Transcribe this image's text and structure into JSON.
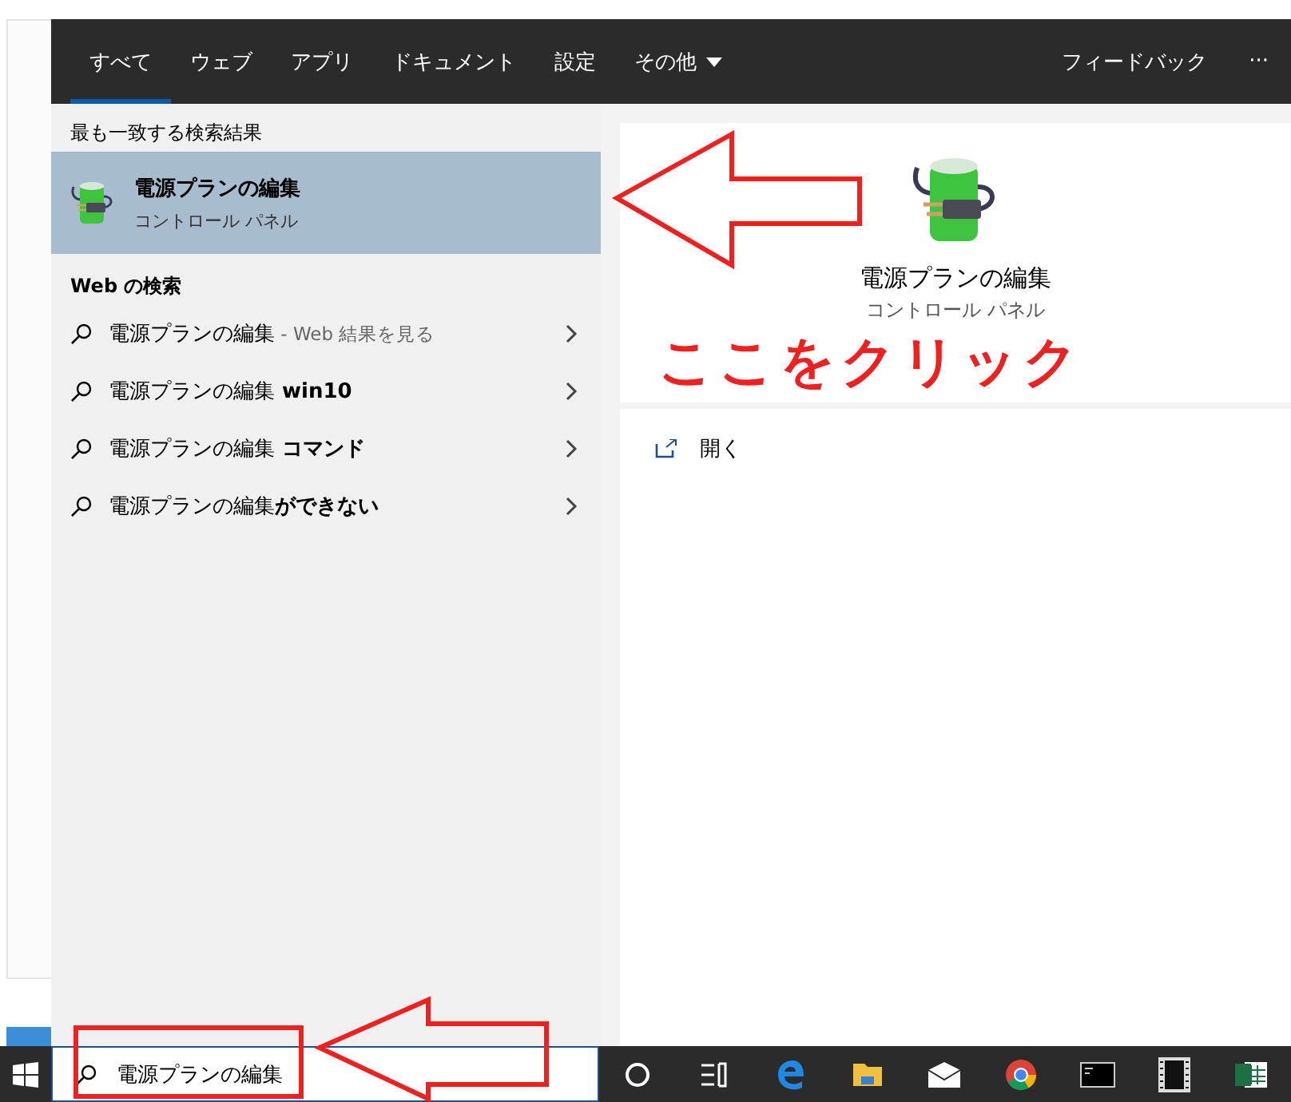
{
  "tabs": [
    {
      "label": "すべて",
      "selected": true,
      "dropdown": false
    },
    {
      "label": "ウェブ",
      "selected": false,
      "dropdown": false
    },
    {
      "label": "アプリ",
      "selected": false,
      "dropdown": false
    },
    {
      "label": "ドキュメント",
      "selected": false,
      "dropdown": false
    },
    {
      "label": "設定",
      "selected": false,
      "dropdown": false
    },
    {
      "label": "その他",
      "selected": false,
      "dropdown": true
    }
  ],
  "toolbar": {
    "feedback": "フィードバック",
    "more": "···"
  },
  "best_match": {
    "heading": "最も一致する検索結果",
    "title": "電源プランの編集",
    "subtitle": "コントロール パネル",
    "selected": true
  },
  "web_search": {
    "heading": "Web の検索",
    "items": [
      {
        "query": "電源プランの編集",
        "suffix": " - Web 結果を見る",
        "kind": "hint"
      },
      {
        "query": "電源プランの編集",
        "suffix": " win10",
        "kind": "bold"
      },
      {
        "query": "電源プランの編集",
        "suffix": " コマンド",
        "kind": "bold"
      },
      {
        "query": "電源プランの編集",
        "suffix": "ができない",
        "kind": "bold"
      }
    ]
  },
  "preview": {
    "title": "電源プランの編集",
    "subtitle": "コントロール パネル",
    "actions": [
      {
        "label": "開く"
      }
    ]
  },
  "taskbar": {
    "search_value": "電源プランの編集"
  },
  "annotation": {
    "text": "ここをクリック"
  }
}
